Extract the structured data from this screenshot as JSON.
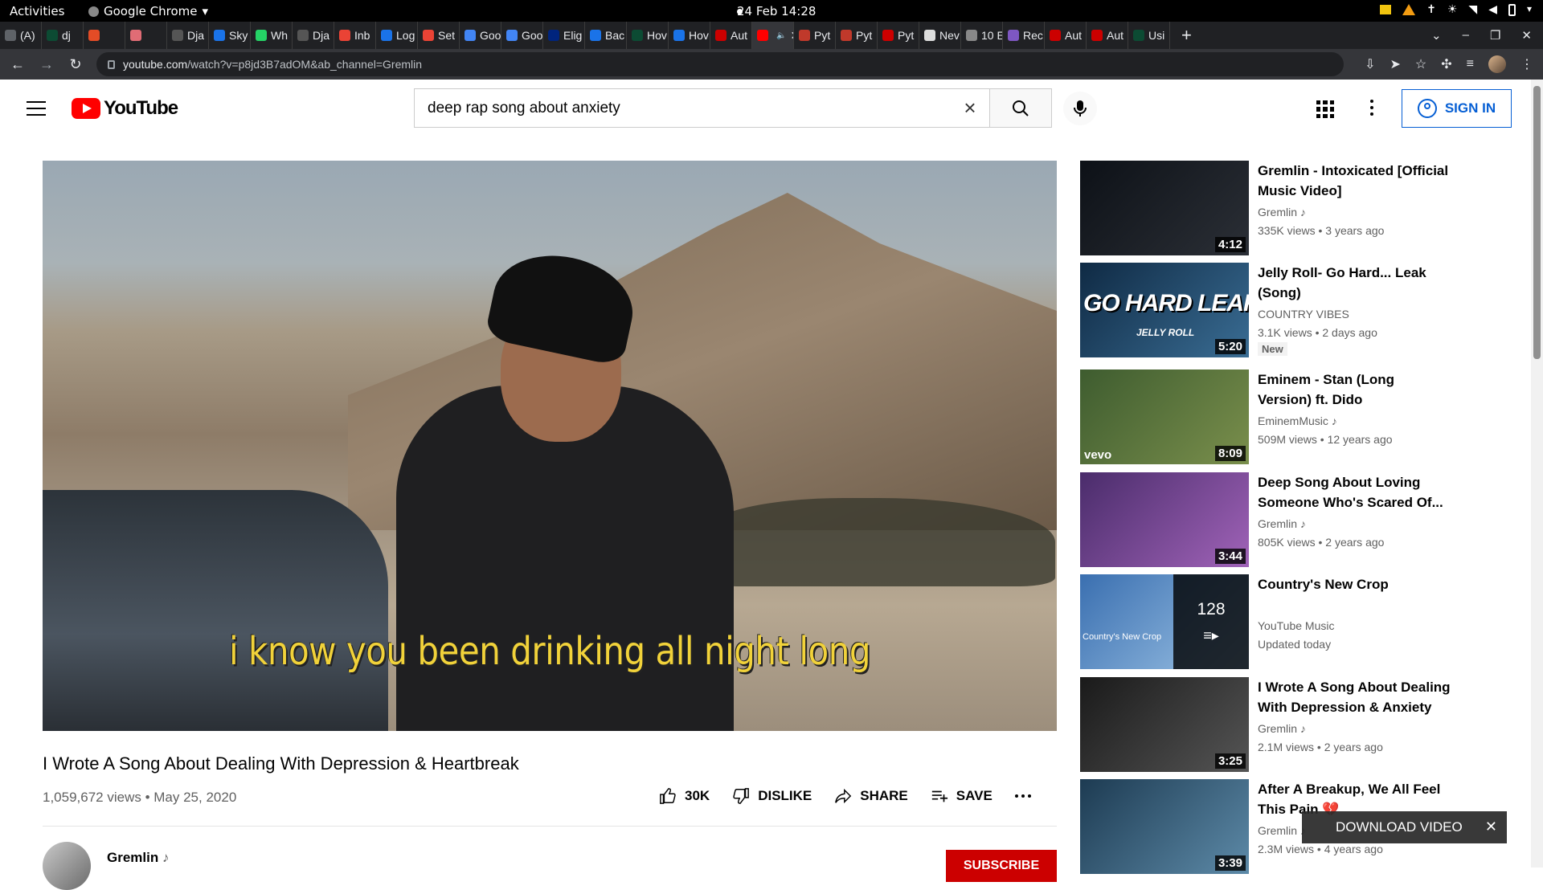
{
  "os": {
    "activities": "Activities",
    "app_name": "Google Chrome",
    "clock": "24 Feb  14:28"
  },
  "tabs": [
    {
      "label": "(A)",
      "color": "#5f6368"
    },
    {
      "label": "dj",
      "color": "#0c4b33"
    },
    {
      "label": "",
      "color": "#e34c26"
    },
    {
      "label": "",
      "color": "#e06c75"
    },
    {
      "label": "Dja",
      "color": "#555"
    },
    {
      "label": "Sky",
      "color": "#1a73e8"
    },
    {
      "label": "Wh",
      "color": "#25d366"
    },
    {
      "label": "Dja",
      "color": "#555"
    },
    {
      "label": "Inb",
      "color": "#ea4335"
    },
    {
      "label": "Log",
      "color": "#1a73e8"
    },
    {
      "label": "Set",
      "color": "#ea4335"
    },
    {
      "label": "Goo",
      "color": "#4285f4"
    },
    {
      "label": "Goo",
      "color": "#4285f4"
    },
    {
      "label": "Elig",
      "color": "#00247d"
    },
    {
      "label": "Bac",
      "color": "#1a73e8"
    },
    {
      "label": "Hov",
      "color": "#0c4b33"
    },
    {
      "label": "Hov",
      "color": "#1a73e8"
    },
    {
      "label": "Aut",
      "color": "#cc0000"
    },
    {
      "label": "",
      "color": "#ff0000",
      "active": true
    },
    {
      "label": "Pyt",
      "color": "#c0392b"
    },
    {
      "label": "Pyt",
      "color": "#c0392b"
    },
    {
      "label": "Pyt",
      "color": "#cc0000"
    },
    {
      "label": "Nev",
      "color": "#dddddd"
    },
    {
      "label": "10 E",
      "color": "#888"
    },
    {
      "label": "Rec",
      "color": "#7e57c2"
    },
    {
      "label": "Aut",
      "color": "#cc0000"
    },
    {
      "label": "Aut",
      "color": "#cc0000"
    },
    {
      "label": "Usi",
      "color": "#0c4b33"
    }
  ],
  "address_bar": {
    "host": "youtube.com",
    "path": "/watch?v=p8jd3B7adOM&ab_channel=Gremlin"
  },
  "header": {
    "logo_text": "YouTube",
    "search_value": "deep rap song about anxiety",
    "sign_in": "SIGN IN"
  },
  "player": {
    "caption": "i know you been drinking all night long"
  },
  "video": {
    "title": "I Wrote A Song About Dealing With Depression & Heartbreak",
    "meta": "1,059,672 views • May 25, 2020",
    "like_count": "30K",
    "dislike": "DISLIKE",
    "share": "SHARE",
    "save": "SAVE",
    "channel": "Gremlin",
    "subscribe": "SUBSCRIBE"
  },
  "recommendations": [
    {
      "title": "Gremlin - Intoxicated [Official Music Video]",
      "channel": "Gremlin",
      "stats": "335K views • 3 years ago",
      "duration": "4:12",
      "thumb": [
        "#0d1117",
        "#2b2f36"
      ]
    },
    {
      "title": "Jelly Roll- Go Hard... Leak (Song)",
      "channel": "COUNTRY VIBES",
      "stats": "3.1K views • 2 days ago",
      "duration": "5:20",
      "badge": "New",
      "thumb_text": "GO HARD LEAK",
      "thumb_sub": "JELLY ROLL",
      "thumb": [
        "#0f2a44",
        "#3a6d94"
      ]
    },
    {
      "title": "Eminem - Stan (Long Version) ft. Dido",
      "channel": "EminemMusic",
      "stats": "509M views • 12 years ago",
      "duration": "8:09",
      "thumb_text": "vevo",
      "thumb": [
        "#3e5c2f",
        "#7a8f4c"
      ]
    },
    {
      "title": "Deep Song About Loving Someone Who's Scared Of...",
      "channel": "Gremlin",
      "stats": "805K views • 2 years ago",
      "duration": "3:44",
      "thumb": [
        "#4a2c6b",
        "#a063b8"
      ]
    },
    {
      "title": "Country's New Crop",
      "channel": "YouTube Music",
      "stats": "Updated today",
      "count": "128",
      "thumb_text": "Country's New Crop",
      "thumb": [
        "#3a6fb0",
        "#9ec4e6"
      ]
    },
    {
      "title": "I Wrote A Song About Dealing With Depression & Anxiety",
      "channel": "Gremlin",
      "stats": "2.1M views • 2 years ago",
      "duration": "3:25",
      "thumb": [
        "#1a1a1a",
        "#555555"
      ]
    },
    {
      "title": "After A Breakup, We All Feel This Pain 💔",
      "channel": "Gremlin",
      "stats": "2.3M views • 4 years ago",
      "duration": "3:39",
      "thumb": [
        "#1d3b52",
        "#5d8aa8"
      ]
    }
  ],
  "download_popup": "DOWNLOAD VIDEO"
}
